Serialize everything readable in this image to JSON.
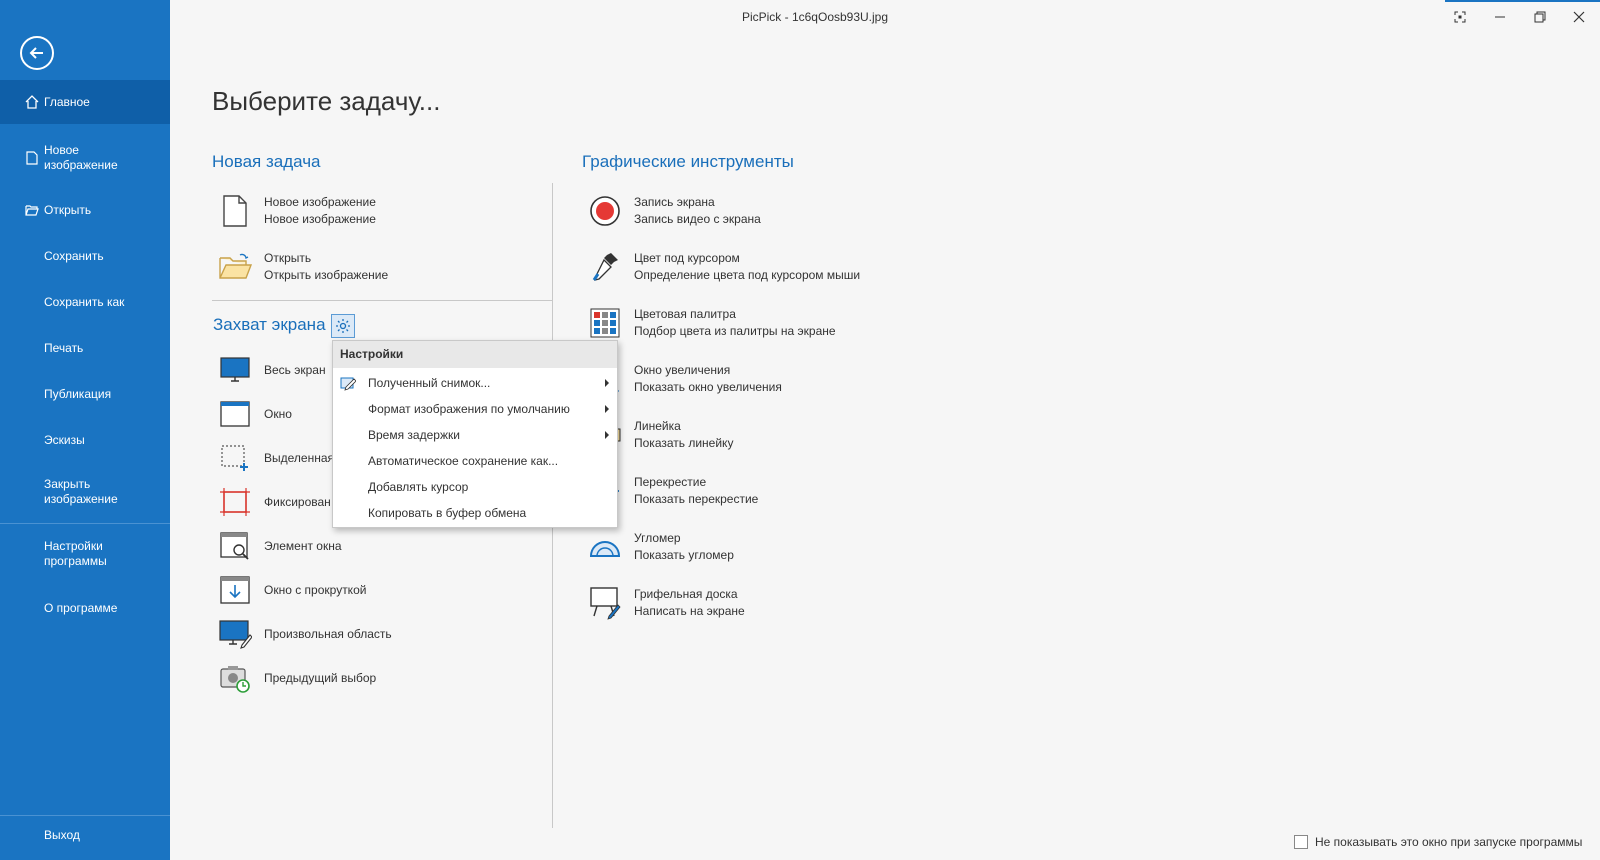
{
  "window": {
    "title": "PicPick - 1c6qOosb93U.jpg"
  },
  "sidebar": {
    "items": [
      {
        "label": "Главное"
      },
      {
        "label": "Новое\nизображение"
      },
      {
        "label": "Открыть"
      },
      {
        "label": "Сохранить"
      },
      {
        "label": "Сохранить как"
      },
      {
        "label": "Печать"
      },
      {
        "label": "Публикация"
      },
      {
        "label": "Эскизы"
      },
      {
        "label": "Закрыть\nизображение"
      },
      {
        "label": "Настройки\nпрограммы"
      },
      {
        "label": "О программе"
      },
      {
        "label": "Выход"
      }
    ]
  },
  "main": {
    "page_title": "Выберите задачу...",
    "new_task": {
      "title": "Новая задача",
      "items": [
        {
          "title": "Новое изображение",
          "subtitle": "Новое изображение",
          "icon": "new-file-icon"
        },
        {
          "title": "Открыть",
          "subtitle": "Открыть изображение",
          "icon": "open-folder-icon"
        }
      ]
    },
    "capture": {
      "title": "Захват экрана",
      "items": [
        {
          "label": "Весь экран",
          "icon": "monitor-icon"
        },
        {
          "label": "Окно",
          "icon": "window-icon"
        },
        {
          "label": "Выделенная",
          "icon": "selection-icon"
        },
        {
          "label": "Фиксирован",
          "icon": "fixed-region-icon"
        },
        {
          "label": "Элемент окна",
          "icon": "window-element-icon"
        },
        {
          "label": "Окно с прокруткой",
          "icon": "scroll-window-icon"
        },
        {
          "label": "Произвольная область",
          "icon": "freehand-icon"
        },
        {
          "label": "Предыдущий выбор",
          "icon": "previous-capture-icon"
        }
      ]
    },
    "tools": {
      "title": "Графические инструменты",
      "items": [
        {
          "title": "Запись экрана",
          "subtitle": "Запись видео с экрана",
          "icon": "record-icon"
        },
        {
          "title": "Цвет под курсором",
          "subtitle": "Определение цвета под курсором мыши",
          "icon": "eyedropper-icon"
        },
        {
          "title": "Цветовая палитра",
          "subtitle": "Подбор цвета из палитры на экране",
          "icon": "palette-icon"
        },
        {
          "title": "Окно увеличения",
          "subtitle": "Показать окно увеличения",
          "icon": "magnifier-icon"
        },
        {
          "title": "Линейка",
          "subtitle": "Показать линейку",
          "icon": "ruler-icon"
        },
        {
          "title": "Перекрестие",
          "subtitle": "Показать перекрестие",
          "icon": "crosshair-icon"
        },
        {
          "title": "Угломер",
          "subtitle": "Показать угломер",
          "icon": "protractor-icon"
        },
        {
          "title": "Грифельная доска",
          "subtitle": "Написать на экране",
          "icon": "whiteboard-icon"
        }
      ]
    }
  },
  "settings_menu": {
    "header": "Настройки",
    "items": [
      {
        "label": "Полученный снимок...",
        "submenu": true
      },
      {
        "label": "Формат изображения по умолчанию",
        "submenu": true
      },
      {
        "label": "Время задержки",
        "submenu": true
      },
      {
        "label": "Автоматическое сохранение как...",
        "submenu": false
      },
      {
        "label": "Добавлять курсор",
        "submenu": false
      },
      {
        "label": "Копировать в буфер обмена",
        "submenu": false
      }
    ]
  },
  "footer": {
    "dont_show_label": "Не показывать это окно при запуске программы"
  },
  "colors": {
    "sidebar": "#1a74c2",
    "sidebar_active": "#0f5fa8",
    "accent_text": "#1a6fba",
    "record_red": "#e53935"
  }
}
